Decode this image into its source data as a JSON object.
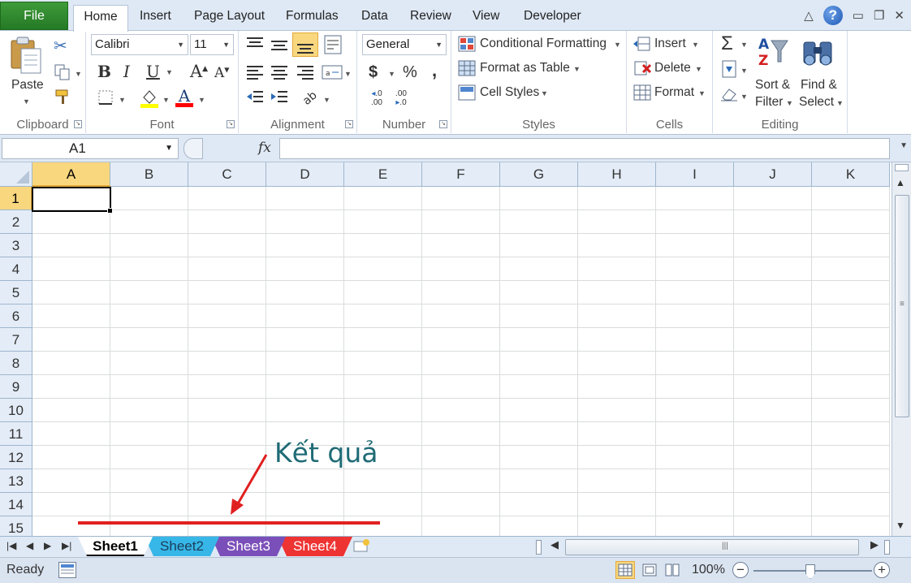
{
  "ribbon_tabs": {
    "file": "File",
    "home": "Home",
    "insert": "Insert",
    "page_layout": "Page Layout",
    "formulas": "Formulas",
    "data": "Data",
    "review": "Review",
    "view": "View",
    "developer": "Developer"
  },
  "clipboard": {
    "paste": "Paste",
    "label": "Clipboard"
  },
  "font": {
    "name": "Calibri",
    "size": "11",
    "bold": "B",
    "italic": "I",
    "underline": "U",
    "grow": "A",
    "shrink": "A",
    "font_color": "A",
    "label": "Font",
    "fill_color": "#ffff00",
    "text_color": "#ff0000"
  },
  "alignment": {
    "label": "Alignment"
  },
  "number": {
    "format": "General",
    "currency": "$",
    "percent": "%",
    "comma": ",",
    "inc_decimal": ".0 .00",
    "dec_decimal": ".00 .0",
    "label": "Number"
  },
  "styles": {
    "conditional": "Conditional Formatting",
    "format_table": "Format as Table",
    "cell_styles": "Cell Styles",
    "label": "Styles"
  },
  "cells": {
    "insert": "Insert",
    "delete": "Delete",
    "format": "Format",
    "label": "Cells"
  },
  "editing": {
    "sum": "Σ",
    "sort_line1": "Sort &",
    "sort_line2": "Filter",
    "find_line1": "Find &",
    "find_line2": "Select",
    "label": "Editing"
  },
  "formula_bar": {
    "name_box": "A1",
    "fx": "fx",
    "formula": ""
  },
  "grid": {
    "columns": [
      "A",
      "B",
      "C",
      "D",
      "E",
      "F",
      "G",
      "H",
      "I",
      "J",
      "K"
    ],
    "rows": [
      "1",
      "2",
      "3",
      "4",
      "5",
      "6",
      "7",
      "8",
      "9",
      "10",
      "11",
      "12",
      "13",
      "14",
      "15"
    ],
    "active_cell": "A1"
  },
  "sheets": {
    "tabs": [
      {
        "name": "Sheet1",
        "color": "#ffffff"
      },
      {
        "name": "Sheet2",
        "color": "#37b7e8"
      },
      {
        "name": "Sheet3",
        "color": "#7b4fb9"
      },
      {
        "name": "Sheet4",
        "color": "#ee3333"
      }
    ]
  },
  "status": {
    "ready": "Ready",
    "zoom": "100%",
    "zoom_out": "−",
    "zoom_in": "+"
  },
  "annotation": {
    "text": "Kết quả",
    "color": "#1f6b76",
    "arrow_color": "#e02020"
  }
}
